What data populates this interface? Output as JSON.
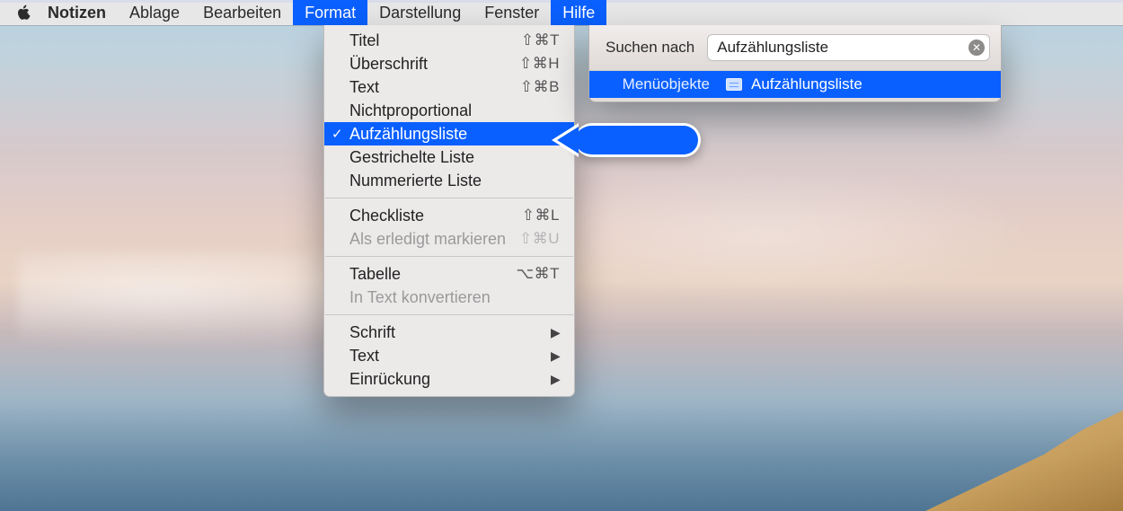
{
  "menubar": {
    "app": "Notizen",
    "items": [
      "Ablage",
      "Bearbeiten",
      "Format",
      "Darstellung",
      "Fenster",
      "Hilfe"
    ]
  },
  "format_menu": {
    "groups": [
      [
        {
          "label": "Titel",
          "shortcut": "⇧⌘T"
        },
        {
          "label": "Überschrift",
          "shortcut": "⇧⌘H"
        },
        {
          "label": "Text",
          "shortcut": "⇧⌘B"
        },
        {
          "label": "Nichtproportional"
        },
        {
          "label": "Aufzählungsliste",
          "selected": true,
          "checked": true
        },
        {
          "label": "Gestrichelte Liste"
        },
        {
          "label": "Nummerierte Liste"
        }
      ],
      [
        {
          "label": "Checkliste",
          "shortcut": "⇧⌘L"
        },
        {
          "label": "Als erledigt markieren",
          "shortcut": "⇧⌘U",
          "disabled": true
        }
      ],
      [
        {
          "label": "Tabelle",
          "shortcut": "⌥⌘T"
        },
        {
          "label": "In Text konvertieren",
          "disabled": true
        }
      ],
      [
        {
          "label": "Schrift",
          "submenu": true
        },
        {
          "label": "Text",
          "submenu": true
        },
        {
          "label": "Einrückung",
          "submenu": true
        }
      ]
    ]
  },
  "help": {
    "search_label": "Suchen nach",
    "search_value": "Aufzählungsliste",
    "category_label": "Menüobjekte",
    "result_label": "Aufzählungsliste"
  }
}
